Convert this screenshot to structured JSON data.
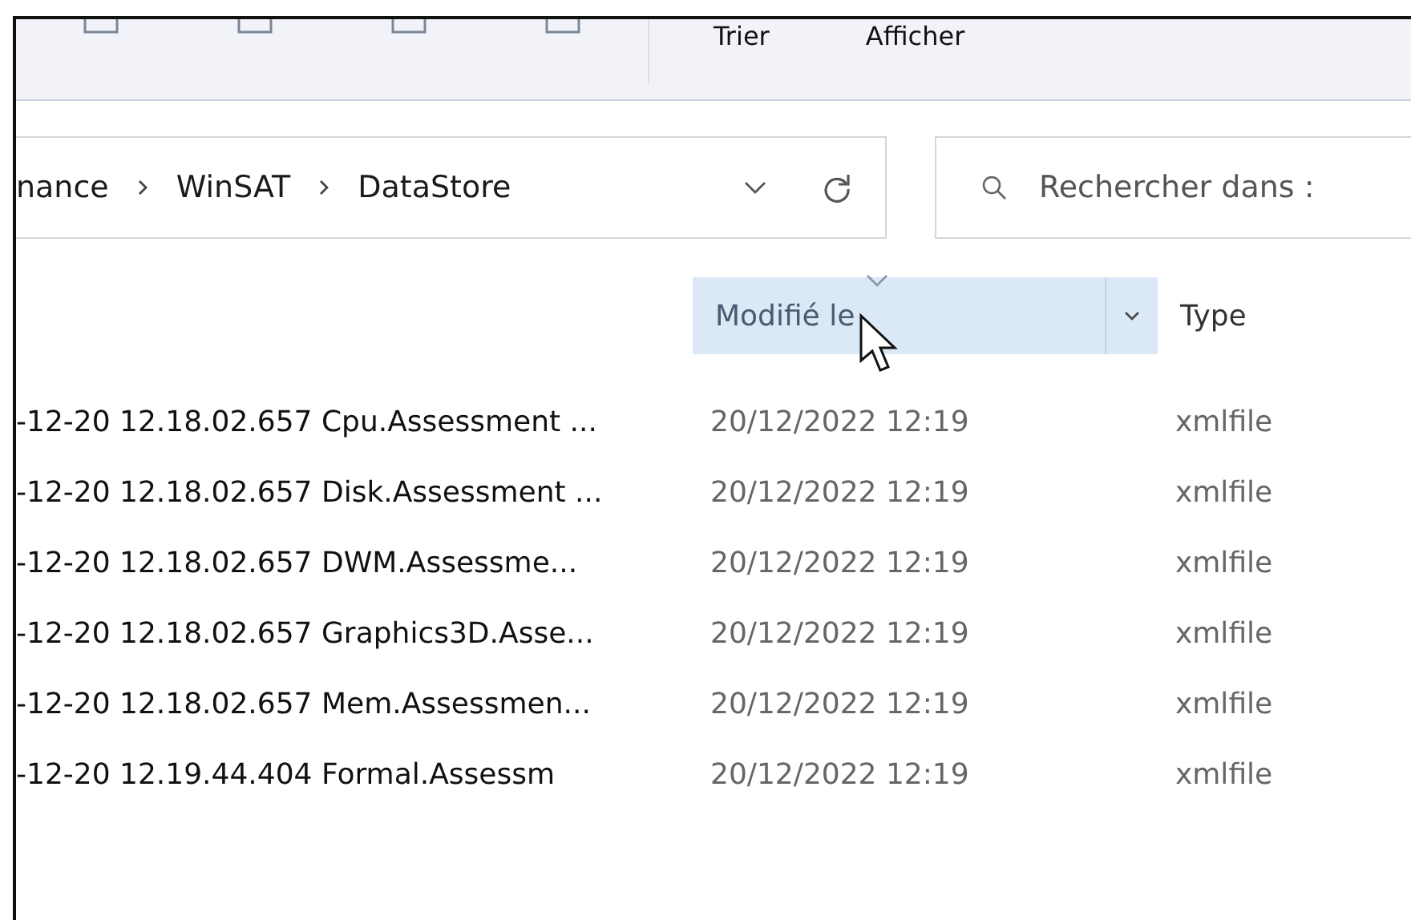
{
  "toolbar": {
    "items": [
      {
        "kind": "icon"
      },
      {
        "kind": "icon"
      },
      {
        "kind": "icon"
      },
      {
        "kind": "icon"
      },
      {
        "kind": "label",
        "label": "Trier"
      },
      {
        "kind": "label",
        "label": "Afficher"
      }
    ]
  },
  "address_bar": {
    "path": [
      "nance",
      "WinSAT",
      "DataStore"
    ]
  },
  "search": {
    "placeholder": "Rechercher dans :"
  },
  "table": {
    "columns": [
      {
        "label": "Modifié le",
        "selected": true
      },
      {
        "label": "Type",
        "selected": false
      }
    ],
    "rows": [
      {
        "name": "-12-20 12.18.02.657 Cpu.Assessment ...",
        "modified": "20/12/2022 12:19",
        "type": "xmlfile"
      },
      {
        "name": "-12-20 12.18.02.657 Disk.Assessment ...",
        "modified": "20/12/2022 12:19",
        "type": "xmlfile"
      },
      {
        "name": "-12-20 12.18.02.657 DWM.Assessme...",
        "modified": "20/12/2022 12:19",
        "type": "xmlfile"
      },
      {
        "name": "-12-20 12.18.02.657 Graphics3D.Asse...",
        "modified": "20/12/2022 12:19",
        "type": "xmlfile"
      },
      {
        "name": "-12-20 12.18.02.657 Mem.Assessmen...",
        "modified": "20/12/2022 12:19",
        "type": "xmlfile"
      },
      {
        "name": "-12-20 12.19.44.404 Formal.Assessm",
        "modified": "20/12/2022 12:19",
        "type": "xmlfile"
      }
    ]
  }
}
